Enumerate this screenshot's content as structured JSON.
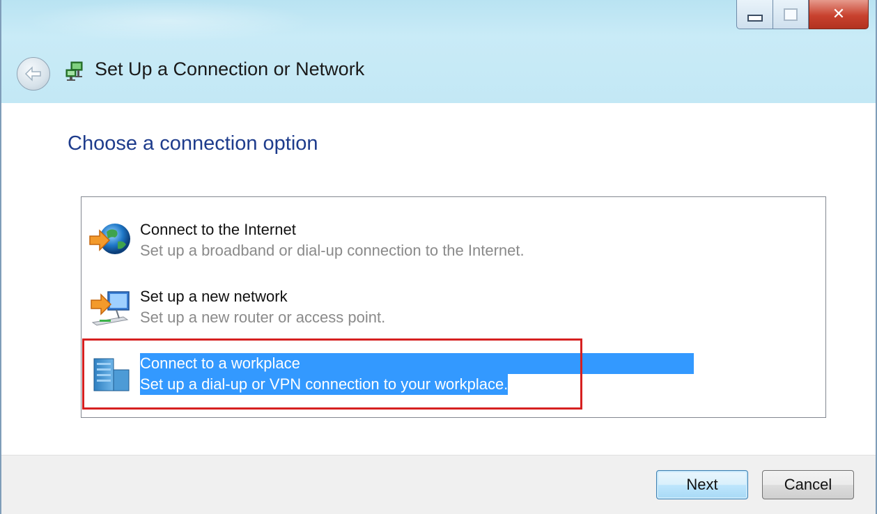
{
  "window": {
    "title": "Set Up a Connection or Network"
  },
  "heading": "Choose a connection option",
  "options": [
    {
      "title": "Connect to the Internet",
      "description": "Set up a broadband or dial-up connection to the Internet.",
      "icon": "globe-arrow-icon",
      "selected": false
    },
    {
      "title": "Set up a new network",
      "description": "Set up a new router or access point.",
      "icon": "router-network-icon",
      "selected": false
    },
    {
      "title": "Connect to a workplace",
      "description": "Set up a dial-up or VPN connection to your workplace.",
      "icon": "workplace-building-icon",
      "selected": true
    }
  ],
  "buttons": {
    "next": "Next",
    "cancel": "Cancel"
  },
  "colors": {
    "selection": "#3399ff",
    "heading": "#1e3c8c",
    "highlight_frame": "#d62020"
  }
}
